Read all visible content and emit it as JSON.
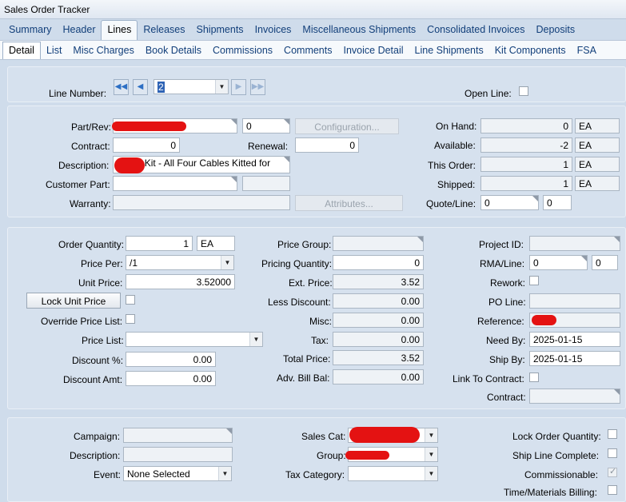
{
  "window_title": "Sales Order Tracker",
  "main_tabs": [
    "Summary",
    "Header",
    "Lines",
    "Releases",
    "Shipments",
    "Invoices",
    "Miscellaneous Shipments",
    "Consolidated Invoices",
    "Deposits"
  ],
  "main_tab_active": "Lines",
  "sub_tabs": [
    "Detail",
    "List",
    "Misc Charges",
    "Book Details",
    "Commissions",
    "Comments",
    "Invoice Detail",
    "Line Shipments",
    "Kit Components",
    "FSA"
  ],
  "sub_tab_active": "Detail",
  "line_nav": {
    "label": "Line Number:",
    "value": "2",
    "open_line_label": "Open Line:"
  },
  "part": {
    "part_rev_label": "Part/Rev:",
    "part_rev_value": "",
    "rev_value": "0",
    "configuration_button": "Configuration...",
    "contract_label": "Contract:",
    "contract_value": "0",
    "renewal_label": "Renewal:",
    "renewal_value": "0",
    "description_label": "Description:",
    "description_value": "Cable Kit - All Four Cables Kitted for",
    "customer_part_label": "Customer Part:",
    "customer_part_value": "",
    "customer_part_extra": "",
    "warranty_label": "Warranty:",
    "warranty_value": "",
    "attributes_button": "Attributes...",
    "on_hand_label": "On Hand:",
    "on_hand_value": "0",
    "on_hand_uom": "EA",
    "available_label": "Available:",
    "available_value": "-2",
    "available_uom": "EA",
    "this_order_label": "This Order:",
    "this_order_value": "1",
    "this_order_uom": "EA",
    "shipped_label": "Shipped:",
    "shipped_value": "1",
    "shipped_uom": "EA",
    "quote_line_label": "Quote/Line:",
    "quote_value": "0",
    "quote_line_value": "0"
  },
  "pricing": {
    "order_quantity_label": "Order Quantity:",
    "order_quantity_value": "1",
    "order_quantity_uom": "EA",
    "price_per_label": "Price Per:",
    "price_per_value": "/1",
    "unit_price_label": "Unit Price:",
    "unit_price_value": "3.52000",
    "lock_unit_price_button": "Lock Unit Price",
    "override_price_list_label": "Override Price List:",
    "price_list_label": "Price List:",
    "price_list_value": "",
    "discount_pct_label": "Discount %:",
    "discount_pct_value": "0.00",
    "discount_amt_label": "Discount Amt:",
    "discount_amt_value": "0.00",
    "price_group_label": "Price Group:",
    "price_group_value": "",
    "pricing_quantity_label": "Pricing Quantity:",
    "pricing_quantity_value": "0",
    "ext_price_label": "Ext. Price:",
    "ext_price_value": "3.52",
    "less_discount_label": "Less Discount:",
    "less_discount_value": "0.00",
    "misc_label": "Misc:",
    "misc_value": "0.00",
    "tax_label": "Tax:",
    "tax_value": "0.00",
    "total_price_label": "Total Price:",
    "total_price_value": "3.52",
    "adv_bill_bal_label": "Adv. Bill Bal:",
    "adv_bill_bal_value": "0.00",
    "project_id_label": "Project ID:",
    "project_id_value": "",
    "rma_line_label": "RMA/Line:",
    "rma_value": "0",
    "rma_line_value": "0",
    "rework_label": "Rework:",
    "po_line_label": "PO Line:",
    "po_line_value": "",
    "reference_label": "Reference:",
    "reference_value": "",
    "need_by_label": "Need By:",
    "need_by_value": "2025-01-15",
    "ship_by_label": "Ship By:",
    "ship_by_value": "2025-01-15",
    "link_to_contract_label": "Link To Contract:",
    "contract_label": "Contract:",
    "contract_value": ""
  },
  "marketing": {
    "campaign_label": "Campaign:",
    "campaign_value": "",
    "description_label": "Description:",
    "description_value": "",
    "event_label": "Event:",
    "event_value": "None Selected",
    "sales_cat_label": "Sales Cat:",
    "sales_cat_value": "",
    "group_label": "Group:",
    "group_value": "",
    "tax_category_label": "Tax Category:",
    "tax_category_value": "",
    "lock_order_quantity_label": "Lock Order Quantity:",
    "ship_line_complete_label": "Ship Line Complete:",
    "commissionable_label": "Commissionable:",
    "commissionable_checked": true,
    "time_materials_label": "Time/Materials Billing:"
  },
  "colors": {
    "redaction": "#e41212",
    "tab_text": "#123f7a",
    "panel": "#d6e1ee"
  }
}
